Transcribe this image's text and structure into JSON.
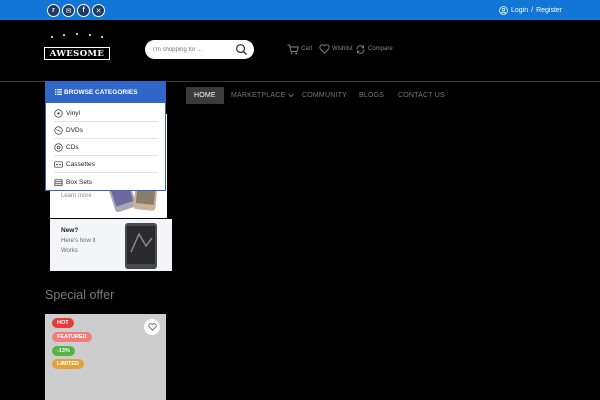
{
  "topbar": {
    "social": [
      {
        "icon": "rss-icon",
        "glyph": "r"
      },
      {
        "icon": "email-icon",
        "glyph": "✉"
      },
      {
        "icon": "facebook-icon",
        "glyph": "f"
      },
      {
        "icon": "x-twitter-icon",
        "glyph": "✕"
      }
    ],
    "login_label": "Login",
    "separator": "/",
    "register_label": "Register",
    "bg_color": "#1176d6"
  },
  "header": {
    "logo_text": "AWESOME",
    "search_placeholder": "I'm shopping for ...",
    "cart_label": "Cart",
    "wishlist_label": "Wishlist",
    "compare_label": "Compare"
  },
  "nav": {
    "items": [
      {
        "label": "HOME"
      },
      {
        "label": "MARKETPLACE"
      },
      {
        "label": "COMMUNITY"
      },
      {
        "label": "BLOGS"
      },
      {
        "label": "CONTACT US"
      }
    ]
  },
  "categories": {
    "title": "BROWSE CATEGORIES",
    "items": [
      {
        "label": "Vinyl",
        "icon": "vinyl-icon"
      },
      {
        "label": "DVDs",
        "icon": "dvd-icon"
      },
      {
        "label": "CDs",
        "icon": "cd-icon"
      },
      {
        "label": "Cassettes",
        "icon": "cassette-icon"
      },
      {
        "label": "Box Sets",
        "icon": "box-set-icon"
      }
    ],
    "accent": "#2f66c8"
  },
  "banners": {
    "first": {
      "link_label": "Learn more"
    },
    "second": {
      "title": "New?",
      "line1": "Here's how it",
      "line2": "Works"
    }
  },
  "special_offer": {
    "title": "Special offer",
    "badges": [
      {
        "label": "HOT",
        "color": "#e83c3c"
      },
      {
        "label": "FEATURED",
        "color": "#f07c7c"
      },
      {
        "label": "-13%",
        "color": "#52b446"
      },
      {
        "label": "LIMITED",
        "color": "#e2a23a"
      }
    ]
  }
}
